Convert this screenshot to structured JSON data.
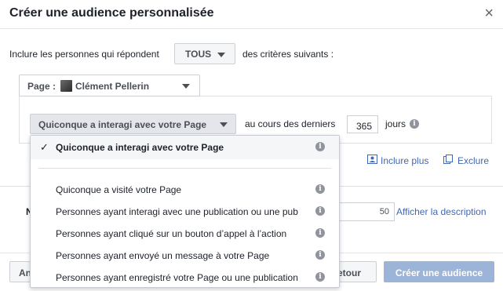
{
  "dialog": {
    "title": "Créer une audience personnalisée",
    "close_glyph": "×"
  },
  "criteria": {
    "prefix": "Inclure les personnes qui répondent",
    "match_value": "TOUS",
    "suffix": "des critères suivants :"
  },
  "page_selector": {
    "label": "Page :",
    "page_name": "Clément Pellerin"
  },
  "rule": {
    "event_value": "Quiconque a interagi avec votre Page",
    "during_label": "au cours des derniers",
    "days_value": "365",
    "days_unit": "jours"
  },
  "actions": {
    "include_more": "Inclure plus",
    "exclude": "Exclure"
  },
  "background": {
    "name_partial": "N",
    "size_value": "50",
    "show_description": "Afficher la description"
  },
  "dropdown": {
    "options": [
      {
        "label": "Quiconque a interagi avec votre Page",
        "selected": true
      },
      {
        "label": "Quiconque a visité votre Page",
        "selected": false
      },
      {
        "label": "Personnes ayant interagi avec une publication ou une pub",
        "selected": false
      },
      {
        "label": "Personnes ayant cliqué sur un bouton d’appel à l’action",
        "selected": false
      },
      {
        "label": "Personnes ayant envoyé un message à votre Page",
        "selected": false
      },
      {
        "label": "Personnes ayant enregistré votre Page ou une publication",
        "selected": false
      }
    ],
    "check_glyph": "✓",
    "info_glyph": "i"
  },
  "footer": {
    "left_button_partial": "An",
    "back_button_partial": "etour",
    "create_button": "Créer une audience"
  },
  "colors": {
    "link": "#4267b2",
    "primary_disabled": "#9cb4d8",
    "info_icon": "#90949c"
  }
}
